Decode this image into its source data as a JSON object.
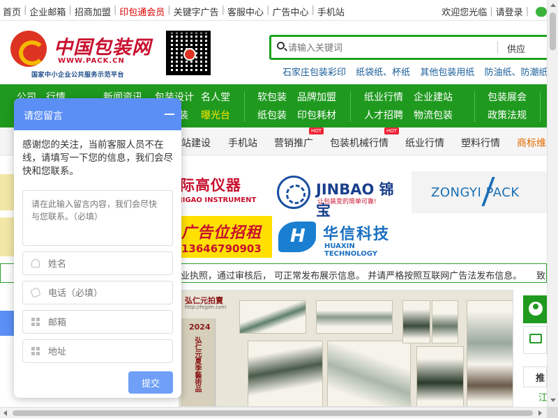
{
  "topbar": {
    "links": [
      "首页",
      "企业邮箱",
      "招商加盟",
      "印包通会员",
      "关键字广告",
      "客服中心",
      "广告中心",
      "手机站"
    ],
    "highlight_index": 3,
    "welcome": "欢迎您光临",
    "login": "请登录"
  },
  "header": {
    "logo_cn": "中国包装网",
    "logo_url": "WWW.PACK.CN",
    "logo_sub": "国家中小企业公共服务示范平台"
  },
  "search": {
    "placeholder": "请输入关键词",
    "category": "供应",
    "hotwords": [
      "石家庄包装彩印",
      "纸袋纸、杯纸",
      "其他包装用纸",
      "防油纸、防潮纸"
    ]
  },
  "greennav": {
    "col1": [
      "公司",
      "行情"
    ],
    "col2": [
      "新闻资讯",
      "包装设计"
    ],
    "col2b": [
      "装"
    ],
    "col3": [
      "名人堂",
      "曝光台"
    ],
    "col4": [
      "软包装",
      "纸包装"
    ],
    "col5": [
      "品牌加盟",
      "印包耗材"
    ],
    "col6": [
      "纸业行情",
      "人才招聘"
    ],
    "col7": [
      "企业建站",
      "物流包装"
    ],
    "col8": [
      "包装展会",
      "政策法规"
    ]
  },
  "subnav": {
    "items": [
      "站建设",
      "手机站",
      "营销推广",
      "包装机械行情",
      "纸业行情",
      "塑料行情",
      "商标维"
    ],
    "hot_label": "HOT"
  },
  "ads": {
    "jigao_name": "际高仪器",
    "jigao_en": "JIGAO INSTRUMENT",
    "jinbao_name": "JINBAO 锦宝",
    "jinbao_slogan": "让包装变的简单可靠!",
    "zongyi": "ZONGYI PACK",
    "rent_title": "广告位招租",
    "rent_phone": "13646790903",
    "huaxin_name": "华信科技",
    "huaxin_en": "HUAXIN TECHNOLOGY"
  },
  "notice": {
    "text": "业执照，通过审核后， 可正常发布展示信息。 并请严格按照互联网广告法发布信息。",
    "tail": "致"
  },
  "banner": {
    "brand": "弘仁元拍賣",
    "brand_url": "http://hrjpm.com",
    "poster_year": "2024",
    "poster_title": "弘仁元夏季藝術品"
  },
  "sidebar": {
    "recommend": "推",
    "green": "江"
  },
  "dialog": {
    "title": "请您留言",
    "message": "感谢您的关注，当前客服人员不在线，请填写一下您的信息，我们会尽快和您联系。",
    "content_placeholder": "请在此输入留言内容，我们会尽快与您联系。（必填）",
    "name_placeholder": "姓名",
    "phone_placeholder": "电话（必填）",
    "email_placeholder": "邮箱",
    "address_placeholder": "地址",
    "submit": "提交"
  }
}
